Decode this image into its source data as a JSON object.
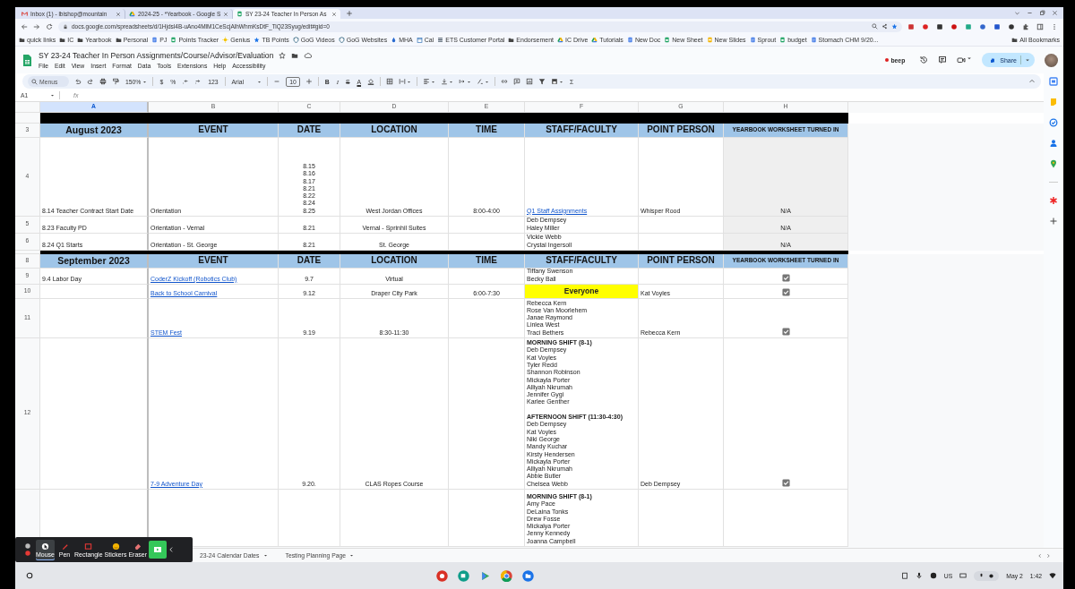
{
  "browser": {
    "tabs": [
      {
        "title": "Inbox (1) - lbishop@mountain",
        "selected": false
      },
      {
        "title": "2024-25 - *Yearbook - Google S",
        "selected": false
      },
      {
        "title": "SY 23-24 Teacher In Person As",
        "selected": true
      }
    ],
    "url": "docs.google.com/spreadsheets/d/1Hjdsl4B-uAno4MlM1CeScjAlhWhmKsDtF_TiQ23Syug/edit#gid=0",
    "bookmarks": [
      "quick links",
      "IC",
      "Yearbook",
      "Personal",
      "PJ",
      "Points Tracker",
      "Genius",
      "TB Points",
      "GoG Videos",
      "GoG Websites",
      "MHA",
      "Cal",
      "ETS Customer Portal",
      "Endorsement",
      "IC Drive",
      "Tutorials",
      "New Doc",
      "New Sheet",
      "New Slides",
      "Sprout",
      "budget",
      "Stomach CHM 9/20..."
    ],
    "all_bookmarks": "All Bookmarks"
  },
  "doc": {
    "title": "SY 23-24 Teacher In Person Assignments/Course/Advisor/Evaluation",
    "menu": [
      "File",
      "Edit",
      "View",
      "Insert",
      "Format",
      "Data",
      "Tools",
      "Extensions",
      "Help",
      "Accessibility"
    ],
    "beep": "beep",
    "share": "Share"
  },
  "toolbar": {
    "search_placeholder": "Menus",
    "zoom": "150%",
    "currency": "$",
    "percent": "%",
    "number_format": "123",
    "font": "Arial",
    "font_size": "10",
    "bold": "B",
    "italic": "I",
    "strikethrough": "S",
    "text_color": "A",
    "functions": "Σ"
  },
  "formula_bar": {
    "cell_ref": "A1",
    "fx": "fx"
  },
  "sheet": {
    "columns": [
      {
        "label": "A",
        "selected": true
      },
      {
        "label": "B",
        "selected": false
      },
      {
        "label": "C",
        "selected": false
      },
      {
        "label": "D",
        "selected": false
      },
      {
        "label": "E",
        "selected": false
      },
      {
        "label": "F",
        "selected": false
      },
      {
        "label": "G",
        "selected": false
      },
      {
        "label": "H",
        "selected": false
      }
    ],
    "rows": [
      {
        "kind": "divider"
      },
      {
        "kind": "header",
        "number": "3",
        "cells": [
          "August 2023",
          "EVENT",
          "DATE",
          "LOCATION",
          "TIME",
          "STAFF/FACULTY",
          "POINT PERSON",
          "YEARBOOK WORKSHEET TURNED IN"
        ]
      },
      {
        "kind": "data",
        "number": "4",
        "cells": [
          "8.14 Teacher Contract Start Date",
          "Orientation",
          "8.15\n8.16\n8.17\n8.21\n8.22\n8.24\n8.25",
          "West Jordan Offices",
          "8:00-4:00",
          {
            "kind": "link",
            "text": "Q1 Staff Assignments"
          },
          "Whisper Rood",
          {
            "kind": "shaded",
            "text": "N/A"
          }
        ]
      },
      {
        "kind": "data",
        "number": "5",
        "cells": [
          "8.23 Faculty PD",
          "Orientation - Vernal",
          "8.21",
          "Vernal - Sprinhil Suites",
          null,
          "Deb Dempsey\nHaley Miller",
          null,
          {
            "kind": "shaded",
            "text": "N/A"
          }
        ]
      },
      {
        "kind": "data",
        "number": "6",
        "cells": [
          "8.24 Q1 Starts",
          "Orientation - St. George",
          "8.21",
          "St. George",
          null,
          "Vickie Webb\nCrystal Ingersoll",
          null,
          {
            "kind": "shaded",
            "text": "N/A"
          }
        ]
      },
      {
        "kind": "divider"
      },
      {
        "kind": "header",
        "number": "8",
        "cells": [
          "September 2023",
          "EVENT",
          "DATE",
          "LOCATION",
          "TIME",
          "STAFF/FACULTY",
          "POINT PERSON",
          "YEARBOOK WORKSHEET TURNED IN"
        ]
      },
      {
        "kind": "data",
        "number": "9",
        "cells": [
          "9.4 Labor Day",
          {
            "kind": "link",
            "text": "CoderZ Kickoff (Robotics Club)"
          },
          "9.7",
          "Virtual",
          null,
          "Tiffany Swenson\nBecky Ball",
          null,
          {
            "kind": "checkbox",
            "checked": true
          }
        ]
      },
      {
        "kind": "data",
        "number": "10",
        "cells": [
          null,
          {
            "kind": "link",
            "text": "Back to School Carnival"
          },
          "9.12",
          "Draper City Park",
          "6:00-7:30",
          {
            "kind": "highlight",
            "text": "Everyone"
          },
          "Kat Voyles",
          {
            "kind": "checkbox",
            "checked": true
          }
        ]
      },
      {
        "kind": "data",
        "number": "11",
        "cells": [
          null,
          {
            "kind": "link",
            "text": "STEM Fest"
          },
          "9.19",
          "8:30-11:30",
          null,
          "Rebecca Kern\nRose Van Moorlehem\nJanae Raymond\nLinlea West\nTraci Bethers",
          "Rebecca Kern",
          {
            "kind": "checkbox",
            "checked": true
          }
        ]
      },
      {
        "kind": "data",
        "number": "12",
        "cells": [
          null,
          {
            "kind": "link",
            "text": "7-9 Adventure Day"
          },
          "9.20.",
          "CLAS Ropes Course",
          null,
          "**MORNING SHIFT (8-1)**\nDeb Dempsey\nKat Voyles\nTyler Redd\nShannon Robinson\nMickayla Porter\nAlliyah Nkrumah\nJennifer Gygi\nKarlee Genther\n\n**AFTERNOON SHIFT (11:30-4:30)**\nDeb Dempsey\nKat Voyles\nNiki George\nMandy Kuchar\nKirsty Hendersen\nMickayla Porter\nAlliyah Nkrumah\nAbbie Butler\nChelsea Webb",
          "Deb Dempsey",
          {
            "kind": "checkbox",
            "checked": true
          }
        ]
      },
      {
        "kind": "data",
        "cells": [
          null,
          null,
          null,
          null,
          null,
          "**MORNING SHIFT (8-1)**\nAmy Pace\nDeLaina Tonks\nDrew Fosse\nMickalya Porter\nJenny Kennedy\nJoanna Campbell",
          null,
          null
        ]
      }
    ]
  },
  "sheet_tabs": [
    {
      "label": "23-24 Calendar Dates",
      "selected": false
    },
    {
      "label": "Testing Planning Page",
      "selected": false
    }
  ],
  "annotation_tools": [
    {
      "label": "Mouse",
      "selected": true
    },
    {
      "label": "Pen",
      "selected": false
    },
    {
      "label": "Rectangle",
      "selected": false
    },
    {
      "label": "Stickers",
      "selected": false
    },
    {
      "label": "Eraser",
      "selected": false
    }
  ],
  "shelf": {
    "keyboard": "US",
    "date": "May 2",
    "time": "1:42"
  }
}
